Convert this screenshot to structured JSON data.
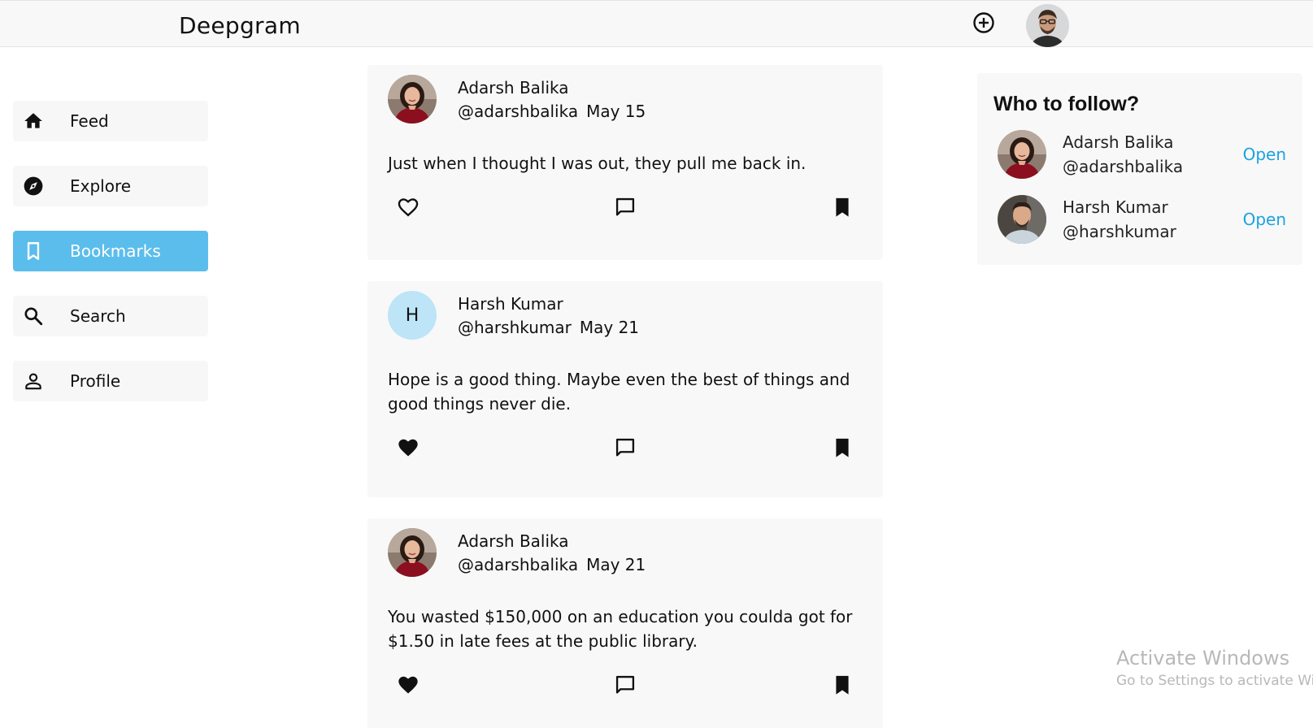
{
  "header": {
    "brand": "Deepgram",
    "add_icon": "plus-circle-icon",
    "avatar": "user-avatar"
  },
  "sidebar": {
    "items": [
      {
        "label": "Feed",
        "icon": "home-icon",
        "active": false
      },
      {
        "label": "Explore",
        "icon": "compass-icon",
        "active": false
      },
      {
        "label": "Bookmarks",
        "icon": "bookmark-icon",
        "active": true
      },
      {
        "label": "Search",
        "icon": "search-icon",
        "active": false
      },
      {
        "label": "Profile",
        "icon": "person-icon",
        "active": false
      }
    ],
    "active_color": "#5bbdec"
  },
  "feed": {
    "posts": [
      {
        "name": "Adarsh Balika",
        "handle": "@adarshbalika",
        "date": "May 15",
        "text": "Just when I thought I was out, they pull me back in.",
        "liked": false,
        "bookmarked": true
      },
      {
        "name": "Harsh Kumar",
        "handle": "@harshkumar",
        "date": "May 21",
        "avatar_letter": "H",
        "text": "Hope is a good thing. Maybe even the best of things and good things never die.",
        "liked": true,
        "bookmarked": true
      },
      {
        "name": "Adarsh Balika",
        "handle": "@adarshbalika",
        "date": "May 21",
        "text": "You wasted $150,000 on an education you coulda got for $1.50 in late fees at the public library.",
        "liked": true,
        "bookmarked": true
      }
    ]
  },
  "follow": {
    "title": "Who to follow?",
    "users": [
      {
        "name": "Adarsh Balika",
        "handle": "@adarshbalika",
        "action": "Open"
      },
      {
        "name": "Harsh Kumar",
        "handle": "@harshkumar",
        "action": "Open"
      }
    ],
    "action_color": "#1aa3e0"
  },
  "watermark": {
    "title": "Activate Windows",
    "subtitle": "Go to Settings to activate Windows."
  }
}
